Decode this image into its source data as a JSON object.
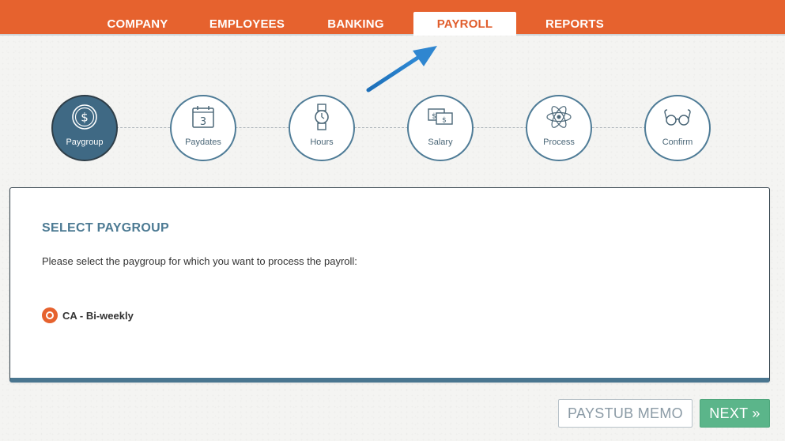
{
  "nav": {
    "tabs": [
      {
        "label": "COMPANY"
      },
      {
        "label": "EMPLOYEES"
      },
      {
        "label": "BANKING"
      },
      {
        "label": "PAYROLL"
      },
      {
        "label": "REPORTS"
      }
    ],
    "active": "PAYROLL"
  },
  "steps": [
    {
      "label": "Paygroup",
      "icon": "dollar-coin-icon",
      "active": true
    },
    {
      "label": "Paydates",
      "icon": "calendar-icon",
      "calendar_number": "3"
    },
    {
      "label": "Hours",
      "icon": "watch-icon"
    },
    {
      "label": "Salary",
      "icon": "money-bills-icon"
    },
    {
      "label": "Process",
      "icon": "atom-icon"
    },
    {
      "label": "Confirm",
      "icon": "glasses-icon"
    }
  ],
  "card": {
    "title": "SELECT PAYGROUP",
    "description": "Please select the paygroup for which you want to process the payroll:",
    "options": [
      {
        "label": "CA - Bi-weekly",
        "selected": true
      }
    ]
  },
  "buttons": {
    "memo_label": "PAYSTUB MEMO",
    "next_label": "NEXT »"
  },
  "colors": {
    "brand_orange": "#e6622e",
    "step_blue": "#4f7c97",
    "next_green": "#5bb58a"
  }
}
